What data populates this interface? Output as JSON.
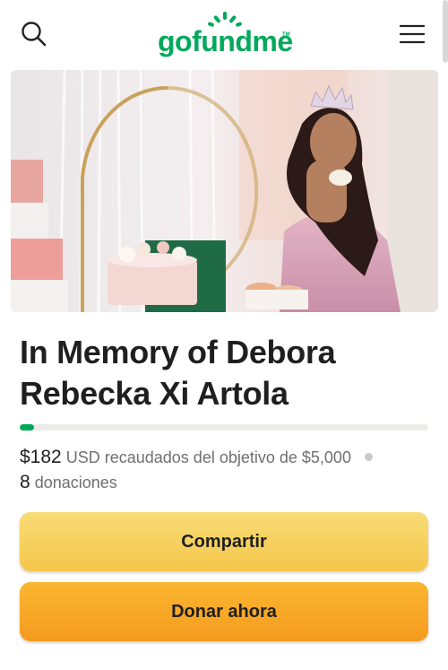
{
  "header": {
    "logo_text": "gofundme",
    "logo_tm": "TM",
    "search_icon": "search-icon",
    "menu_icon": "hamburger-menu-icon",
    "brand_color": "#02a95c"
  },
  "campaign": {
    "title": "In Memory of Debora Rebecka Xi Artola",
    "raised_amount": "$182",
    "raised_text": "USD recaudados del objetivo de $5,000",
    "donation_count": "8",
    "donation_label": "donaciones",
    "progress_fraction": 0.036
  },
  "actions": {
    "share_label": "Compartir",
    "donate_label": "Donar ahora",
    "share_color": "#f7d160",
    "donate_color": "#f9a825"
  }
}
